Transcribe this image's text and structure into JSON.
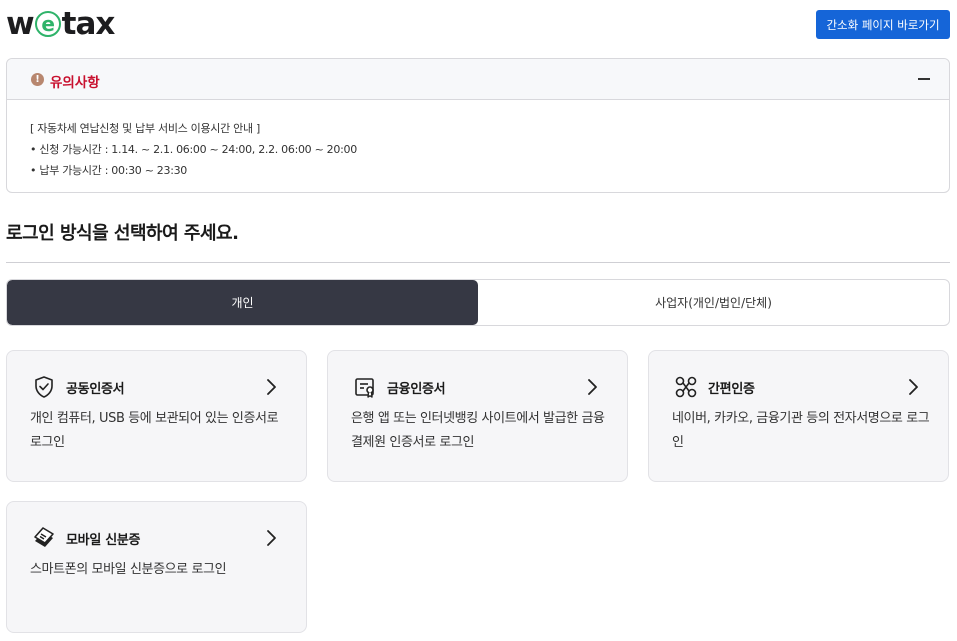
{
  "header": {
    "logo": {
      "pre": "w",
      "e": "e",
      "post": "tax"
    },
    "simple_page_button": "간소화 페이지 바로가기"
  },
  "notice": {
    "title": "유의사항",
    "icon_glyph": "!",
    "lines": [
      "[ 자동차세 연납신청 및 납부 서비스 이용시간 안내 ]",
      "• 신청 가능시간 : 1.14. ~ 2.1. 06:00 ~ 24:00, 2.2. 06:00 ~ 20:00",
      "• 납부 가능시간 : 00:30 ~ 23:30"
    ]
  },
  "main": {
    "title": "로그인 방식을 선택하여 주세요.",
    "tabs": [
      {
        "label": "개인",
        "active": true
      },
      {
        "label": "사업자(개인/법인/단체)",
        "active": false
      }
    ],
    "cards": [
      {
        "title": "공동인증서",
        "icon": "shield-check-icon",
        "desc": "개인 컴퓨터, USB 등에 보관되어 있는 인증서로 로그인"
      },
      {
        "title": "금융인증서",
        "icon": "certificate-icon",
        "desc": "은행 앱 또는 인터넷뱅킹 사이트에서 발급한 금융결제원 인증서로 로그인"
      },
      {
        "title": "간편인증",
        "icon": "link-nodes-icon",
        "desc": "네이버, 카카오, 금융기관 등의 전자서명으로 로그인"
      },
      {
        "title": "모바일 신분증",
        "icon": "mobile-id-icon",
        "desc": "스마트폰의 모바일 신분증으로 로그인"
      }
    ]
  },
  "colors": {
    "primary_button": "#1565d8",
    "notice_title": "#c8102e",
    "active_tab": "#363844",
    "logo_accent": "#2fb36a"
  }
}
